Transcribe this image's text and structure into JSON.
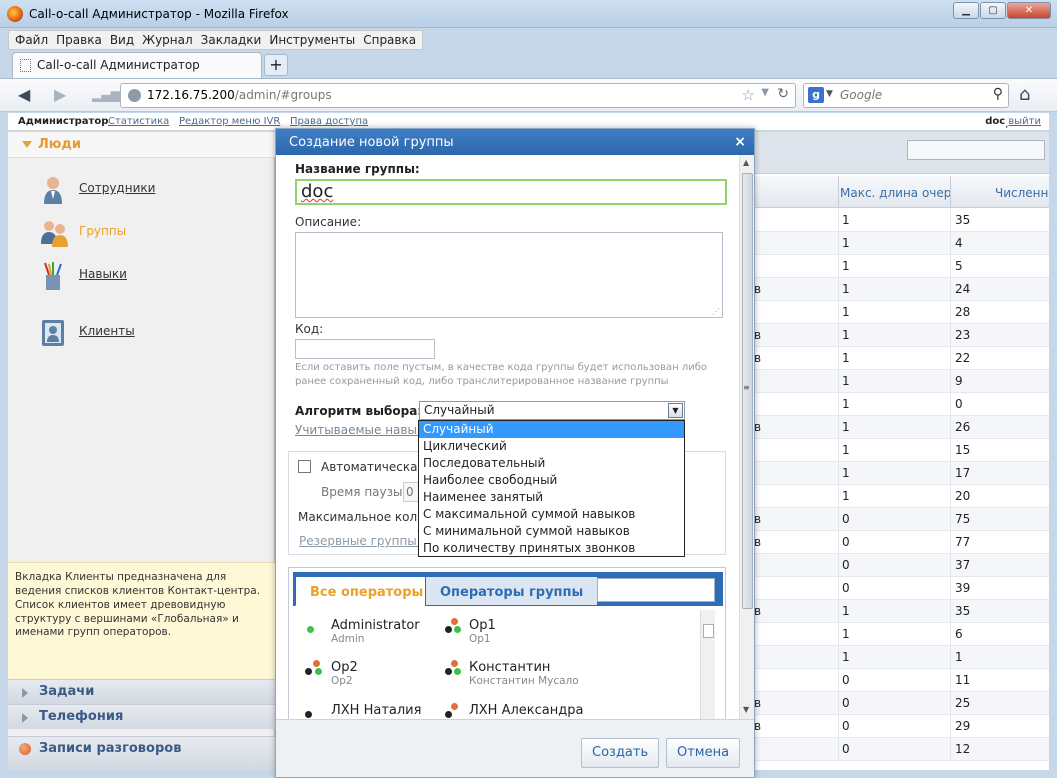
{
  "browser": {
    "window_title": "Call-o-call Администратор - Mozilla Firefox",
    "menu": [
      "Файл",
      "Правка",
      "Вид",
      "Журнал",
      "Закладки",
      "Инструменты",
      "Справка"
    ],
    "tab_title": "Call-o-call Администратор",
    "new_tab": "+",
    "url_host": "172.16.75.200",
    "url_path": "/admin/#groups",
    "search_placeholder": "Google",
    "search_engine_letter": "g"
  },
  "app_nav": {
    "current": "Администратор",
    "links": [
      "Статистика",
      "Редактор меню IVR",
      "Права доступа"
    ],
    "user": "doc",
    "separator": ",",
    "logout": "выйти"
  },
  "sidebar": {
    "section": "Люди",
    "items": [
      {
        "label": "Сотрудники",
        "icon": "employee-icon"
      },
      {
        "label": "Группы",
        "icon": "groups-icon"
      },
      {
        "label": "Навыки",
        "icon": "skills-icon"
      },
      {
        "label": "Клиенты",
        "icon": "clients-icon"
      }
    ],
    "info": "Вкладка Клиенты предназначена для ведения списков клиентов Контакт-центра. Список клиентов имеет древовидную структуру с вершинами «Глобальная» и именами групп операторов.",
    "sections": [
      "Задачи",
      "Телефония"
    ],
    "recordings": "Записи разговоров"
  },
  "grid": {
    "columns": [
      "Макс. длина очер",
      "Численн"
    ],
    "rows": [
      {
        "a": "",
        "b": "1",
        "c": "35"
      },
      {
        "a": "",
        "b": "1",
        "c": "4"
      },
      {
        "a": "",
        "b": "1",
        "c": "5"
      },
      {
        "a": "в",
        "b": "1",
        "c": "24"
      },
      {
        "a": "",
        "b": "1",
        "c": "28"
      },
      {
        "a": "в",
        "b": "1",
        "c": "23"
      },
      {
        "a": "в",
        "b": "1",
        "c": "22"
      },
      {
        "a": "",
        "b": "1",
        "c": "9"
      },
      {
        "a": "",
        "b": "1",
        "c": "0"
      },
      {
        "a": "в",
        "b": "1",
        "c": "26"
      },
      {
        "a": "",
        "b": "1",
        "c": "15"
      },
      {
        "a": "",
        "b": "1",
        "c": "17"
      },
      {
        "a": "",
        "b": "1",
        "c": "20"
      },
      {
        "a": "в",
        "b": "0",
        "c": "75"
      },
      {
        "a": "в",
        "b": "0",
        "c": "77"
      },
      {
        "a": "",
        "b": "0",
        "c": "37"
      },
      {
        "a": "",
        "b": "0",
        "c": "39"
      },
      {
        "a": "в",
        "b": "1",
        "c": "35"
      },
      {
        "a": "",
        "b": "1",
        "c": "6"
      },
      {
        "a": "",
        "b": "1",
        "c": "1"
      },
      {
        "a": "",
        "b": "0",
        "c": "11"
      },
      {
        "a": "в",
        "b": "0",
        "c": "25"
      },
      {
        "a": "в",
        "b": "0",
        "c": "29"
      },
      {
        "a": "",
        "b": "0",
        "c": "12"
      }
    ]
  },
  "modal": {
    "title": "Создание новой группы",
    "close": "×",
    "name_label": "Название группы:",
    "name_value": "doc",
    "desc_label": "Описание:",
    "code_label": "Код:",
    "code_hint": "Если оставить поле пустым, в качестве кода группы будет использован либо ранее сохраненный код, либо транслитерированное название группы",
    "algo_label": "Алгоритм выбора:",
    "algo_value": "Случайный",
    "skills_link": "Учитываемые навык",
    "auto_label": "Автоматическая",
    "pause_label": "Время паузы",
    "pause_value": "0",
    "max_label": "Максимальное коли",
    "reserve_link": "Резервные группы...",
    "tabs": [
      "Все операторы",
      "Операторы группы"
    ],
    "operators": [
      {
        "name": "Administrator",
        "login": "Admin",
        "status": "online"
      },
      {
        "name": "Op1",
        "login": "Op1",
        "status": "mixed"
      },
      {
        "name": "Op2",
        "login": "Op2",
        "status": "mixed"
      },
      {
        "name": "Константин",
        "login": "Константин Мусало",
        "status": "mixed"
      },
      {
        "name": "ЛХН Наталия",
        "login": "",
        "status": "offline"
      },
      {
        "name": "ЛХН Александра",
        "login": "",
        "status": "mixed"
      }
    ],
    "buttons": {
      "create": "Создать",
      "cancel": "Отмена"
    }
  },
  "dropdown": {
    "options": [
      "Случайный",
      "Циклический",
      "Последовательный",
      "Наиболее свободный",
      "Наименее занятый",
      "С максимальной суммой навыков",
      "С минимальной суммой навыков",
      "По количеству принятых звонков"
    ],
    "selected": "Случайный"
  },
  "colors": {
    "accent": "#e8a12e",
    "title_bar": "#2c67ad",
    "selection": "#3399ff",
    "status_online": "#3ec04a",
    "status_busy": "#e0703a",
    "status_offline": "#222222"
  }
}
